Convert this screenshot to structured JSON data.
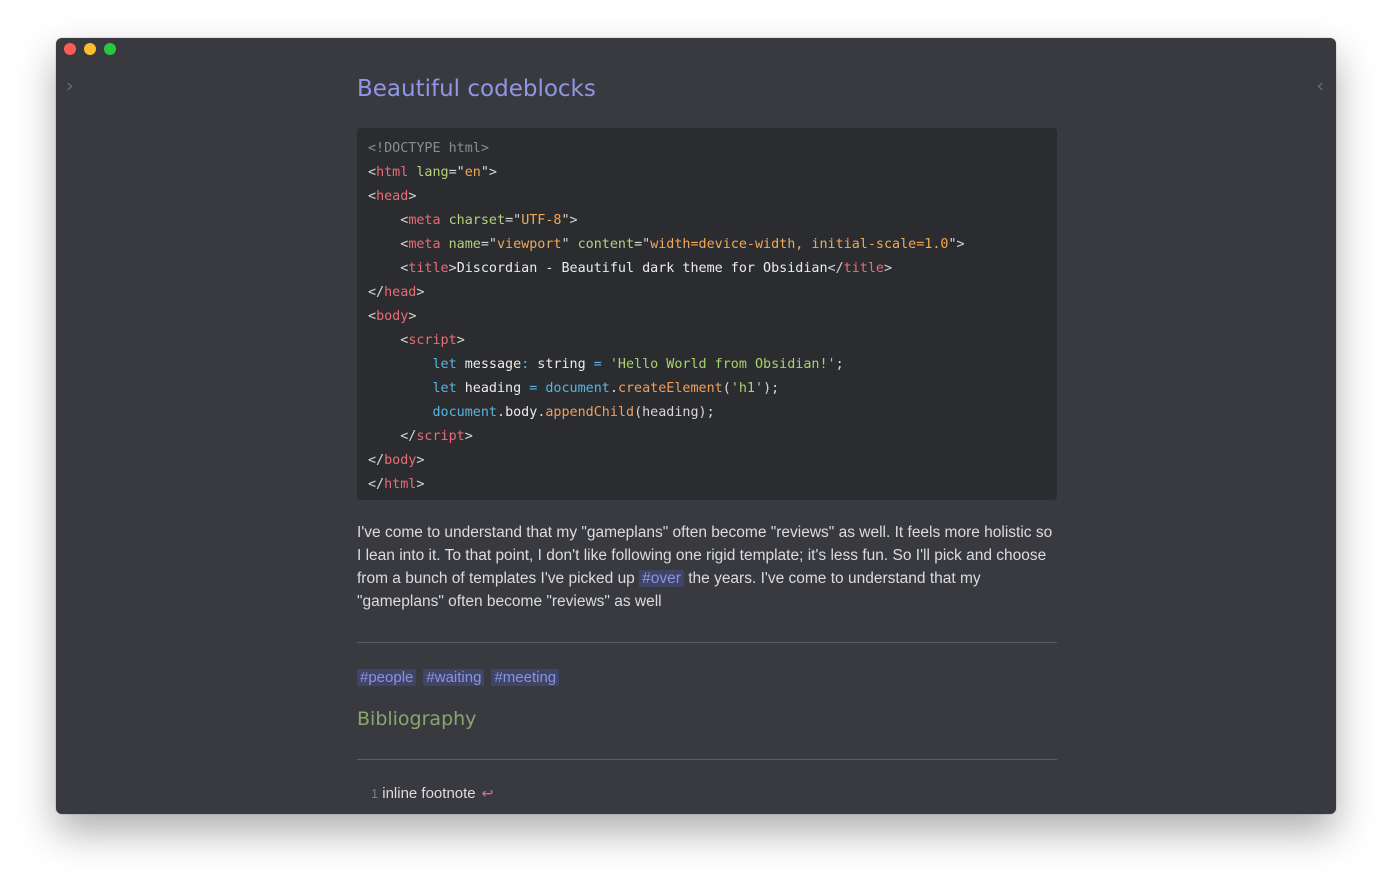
{
  "window": {
    "traffic_colors": {
      "close": "#fd5b57",
      "minimize": "#febc2e",
      "maximize": "#28c840"
    },
    "left_toggle": "›",
    "right_toggle": "‹"
  },
  "note": {
    "title": "Beautiful codeblocks",
    "code_lines": [
      [
        {
          "c": "cm",
          "t": "<!DOCTYPE html>"
        }
      ],
      [
        {
          "c": "pn",
          "t": "<"
        },
        {
          "c": "tg",
          "t": "html"
        },
        {
          "c": "pn",
          "t": " "
        },
        {
          "c": "at",
          "t": "lang"
        },
        {
          "c": "pn",
          "t": "=\""
        },
        {
          "c": "st",
          "t": "en"
        },
        {
          "c": "pn",
          "t": "\">"
        }
      ],
      [
        {
          "c": "pn",
          "t": "<"
        },
        {
          "c": "tg",
          "t": "head"
        },
        {
          "c": "pn",
          "t": ">"
        }
      ],
      [
        {
          "c": "pn",
          "t": "    <"
        },
        {
          "c": "tg",
          "t": "meta"
        },
        {
          "c": "pn",
          "t": " "
        },
        {
          "c": "at",
          "t": "charset"
        },
        {
          "c": "pn",
          "t": "=\""
        },
        {
          "c": "st",
          "t": "UTF-8"
        },
        {
          "c": "pn",
          "t": "\">"
        }
      ],
      [
        {
          "c": "pn",
          "t": "    <"
        },
        {
          "c": "tg",
          "t": "meta"
        },
        {
          "c": "pn",
          "t": " "
        },
        {
          "c": "at",
          "t": "name"
        },
        {
          "c": "pn",
          "t": "=\""
        },
        {
          "c": "st",
          "t": "viewport"
        },
        {
          "c": "pn",
          "t": "\" "
        },
        {
          "c": "at",
          "t": "content"
        },
        {
          "c": "pn",
          "t": "=\""
        },
        {
          "c": "st",
          "t": "width=device-width, initial-scale=1.0"
        },
        {
          "c": "pn",
          "t": "\">"
        }
      ],
      [
        {
          "c": "pn",
          "t": "    <"
        },
        {
          "c": "tg",
          "t": "title"
        },
        {
          "c": "pn",
          "t": ">"
        },
        {
          "c": "tx",
          "t": "Discordian - Beautiful dark theme for Obsidian"
        },
        {
          "c": "pn",
          "t": "</"
        },
        {
          "c": "tg",
          "t": "title"
        },
        {
          "c": "pn",
          "t": ">"
        }
      ],
      [
        {
          "c": "pn",
          "t": "</"
        },
        {
          "c": "tg",
          "t": "head"
        },
        {
          "c": "pn",
          "t": ">"
        }
      ],
      [
        {
          "c": "pn",
          "t": "<"
        },
        {
          "c": "tg",
          "t": "body"
        },
        {
          "c": "pn",
          "t": ">"
        }
      ],
      [
        {
          "c": "pn",
          "t": "    <"
        },
        {
          "c": "tg",
          "t": "script"
        },
        {
          "c": "pn",
          "t": ">"
        }
      ],
      [
        {
          "c": "pn",
          "t": "        "
        },
        {
          "c": "kw",
          "t": "let"
        },
        {
          "c": "tx",
          "t": " message"
        },
        {
          "c": "kw",
          "t": ":"
        },
        {
          "c": "tx",
          "t": " string "
        },
        {
          "c": "kw",
          "t": "="
        },
        {
          "c": "pn",
          "t": " "
        },
        {
          "c": "st2",
          "t": "'Hello World from Obsidian!'"
        },
        {
          "c": "pn",
          "t": ";"
        }
      ],
      [
        {
          "c": "pn",
          "t": "        "
        },
        {
          "c": "kw",
          "t": "let"
        },
        {
          "c": "tx",
          "t": " heading "
        },
        {
          "c": "kw",
          "t": "="
        },
        {
          "c": "pn",
          "t": " "
        },
        {
          "c": "kw",
          "t": "document"
        },
        {
          "c": "pn",
          "t": "."
        },
        {
          "c": "fn",
          "t": "createElement"
        },
        {
          "c": "pn",
          "t": "("
        },
        {
          "c": "st2",
          "t": "'h1'"
        },
        {
          "c": "pn",
          "t": ");"
        }
      ],
      [
        {
          "c": "pn",
          "t": "        "
        },
        {
          "c": "kw",
          "t": "document"
        },
        {
          "c": "pn",
          "t": "."
        },
        {
          "c": "tx",
          "t": "body"
        },
        {
          "c": "pn",
          "t": "."
        },
        {
          "c": "fn",
          "t": "appendChild"
        },
        {
          "c": "pn",
          "t": "(heading);"
        }
      ],
      [
        {
          "c": "pn",
          "t": "    </"
        },
        {
          "c": "tg",
          "t": "script"
        },
        {
          "c": "pn",
          "t": ">"
        }
      ],
      [
        {
          "c": "pn",
          "t": "</"
        },
        {
          "c": "tg",
          "t": "body"
        },
        {
          "c": "pn",
          "t": ">"
        }
      ],
      [
        {
          "c": "pn",
          "t": "</"
        },
        {
          "c": "tg",
          "t": "html"
        },
        {
          "c": "pn",
          "t": ">"
        }
      ]
    ],
    "paragraph_before_tag": "I've come to understand that my \"gameplans\" often become \"reviews\" as well. It feels more holistic so I lean into it. To that point, I don't like following one rigid template; it's less fun. So I'll pick and choose from a bunch of templates I've picked up",
    "inline_tag": "#over",
    "paragraph_after_tag": " the years. I've come to understand that my \"gameplans\" often become \"reviews\" as well",
    "tags": [
      "#people",
      "#waiting",
      "#meeting"
    ],
    "bibliography_heading": "Bibliography",
    "footnote": {
      "number": "1",
      "text": "inline footnote",
      "back_icon": "↩"
    }
  }
}
